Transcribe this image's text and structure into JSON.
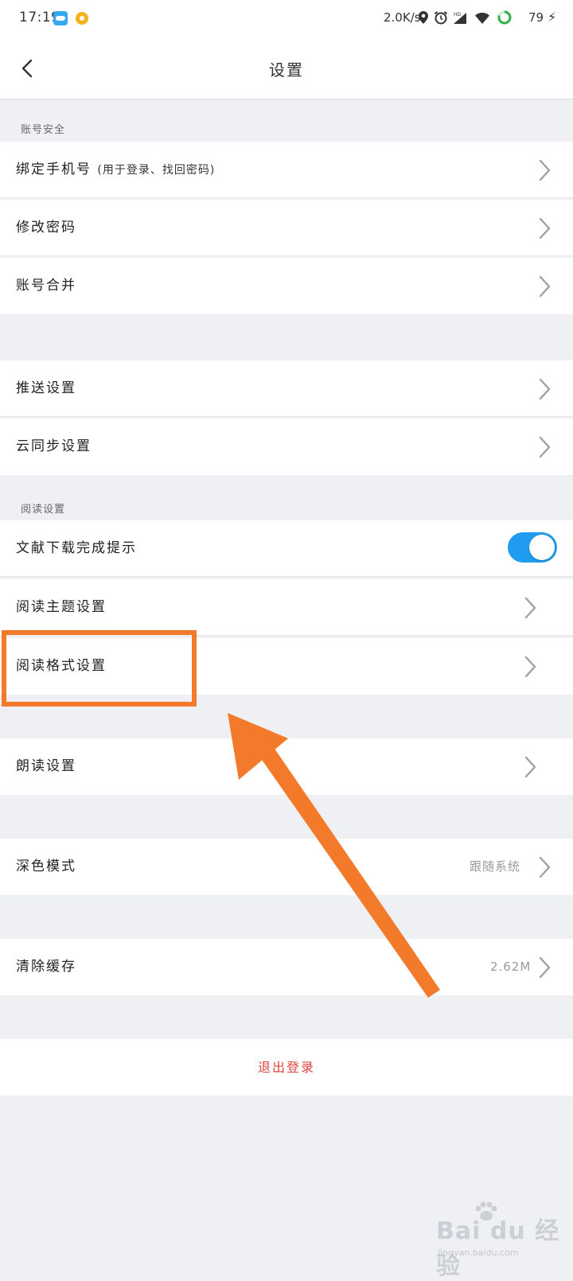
{
  "status_bar": {
    "time": "17:19",
    "net_speed": "2.0K/s",
    "battery": "79",
    "icons": [
      "cloud-app-icon",
      "cat-app-icon",
      "location-icon",
      "alarm-icon",
      "hd-signal-icon",
      "wifi-icon",
      "battery-ring-icon",
      "charging-bolt-icon"
    ]
  },
  "nav": {
    "title": "设置",
    "back_icon": "chevron-left-icon"
  },
  "sections": {
    "account": {
      "header": "账号安全",
      "bind_phone": "绑定手机号",
      "bind_phone_sub": "(用于登录、找回密码)",
      "change_password": "修改密码",
      "merge_account": "账号合并"
    },
    "sync": {
      "push": "推送设置",
      "cloud_sync": "云同步设置"
    },
    "reading": {
      "header": "阅读设置",
      "download_notice": "文献下载完成提示",
      "download_notice_on": true,
      "theme": "阅读主题设置",
      "format": "阅读格式设置"
    },
    "read_aloud": "朗读设置",
    "dark_mode": {
      "label": "深色模式",
      "value": "跟随系统"
    },
    "cache": {
      "label": "清除缓存",
      "value": "2.62M"
    },
    "logout": "退出登录"
  },
  "colors": {
    "accent_toggle": "#1f9cf0",
    "logout": "#e0443e",
    "annotation": "#f47a2b",
    "background": "#eef0f4"
  },
  "watermark": {
    "brand": "Bai du 经验",
    "url": "jingyan.baidu.com"
  }
}
